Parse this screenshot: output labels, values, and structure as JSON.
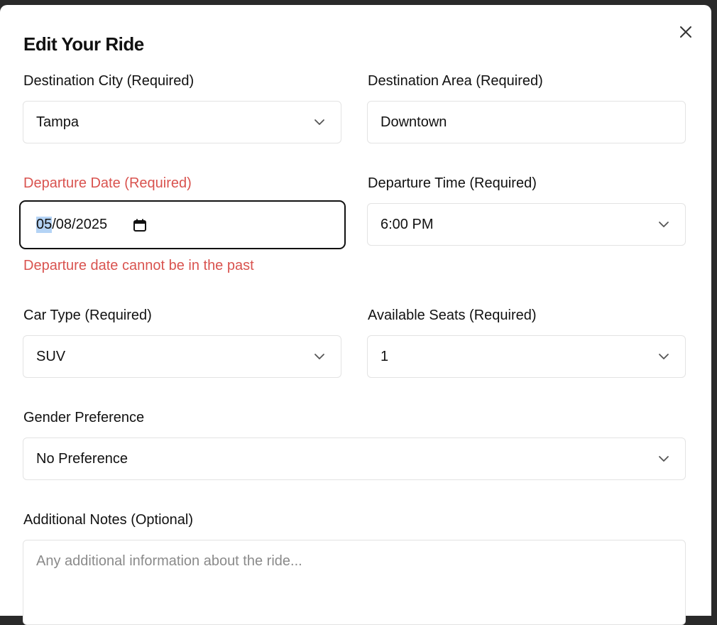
{
  "modal": {
    "title": "Edit Your Ride"
  },
  "form": {
    "destination_city": {
      "label": "Destination City (Required)",
      "value": "Tampa"
    },
    "destination_area": {
      "label": "Destination Area (Required)",
      "value": "Downtown"
    },
    "departure_date": {
      "label": "Departure Date (Required)",
      "month": "05",
      "rest": "/08/2025",
      "error": "Departure date cannot be in the past"
    },
    "departure_time": {
      "label": "Departure Time (Required)",
      "value": "6:00 PM"
    },
    "car_type": {
      "label": "Car Type (Required)",
      "value": "SUV"
    },
    "available_seats": {
      "label": "Available Seats (Required)",
      "value": "1"
    },
    "gender_preference": {
      "label": "Gender Preference",
      "value": "No Preference"
    },
    "notes": {
      "label": "Additional Notes (Optional)",
      "placeholder": "Any additional information about the ride..."
    }
  },
  "colors": {
    "error": "#d9534f",
    "selection": "#b4d3f5",
    "border": "#e3e3e3",
    "focus": "#111111"
  },
  "icons": [
    "close-icon",
    "chevron-down-icon",
    "calendar-icon"
  ]
}
